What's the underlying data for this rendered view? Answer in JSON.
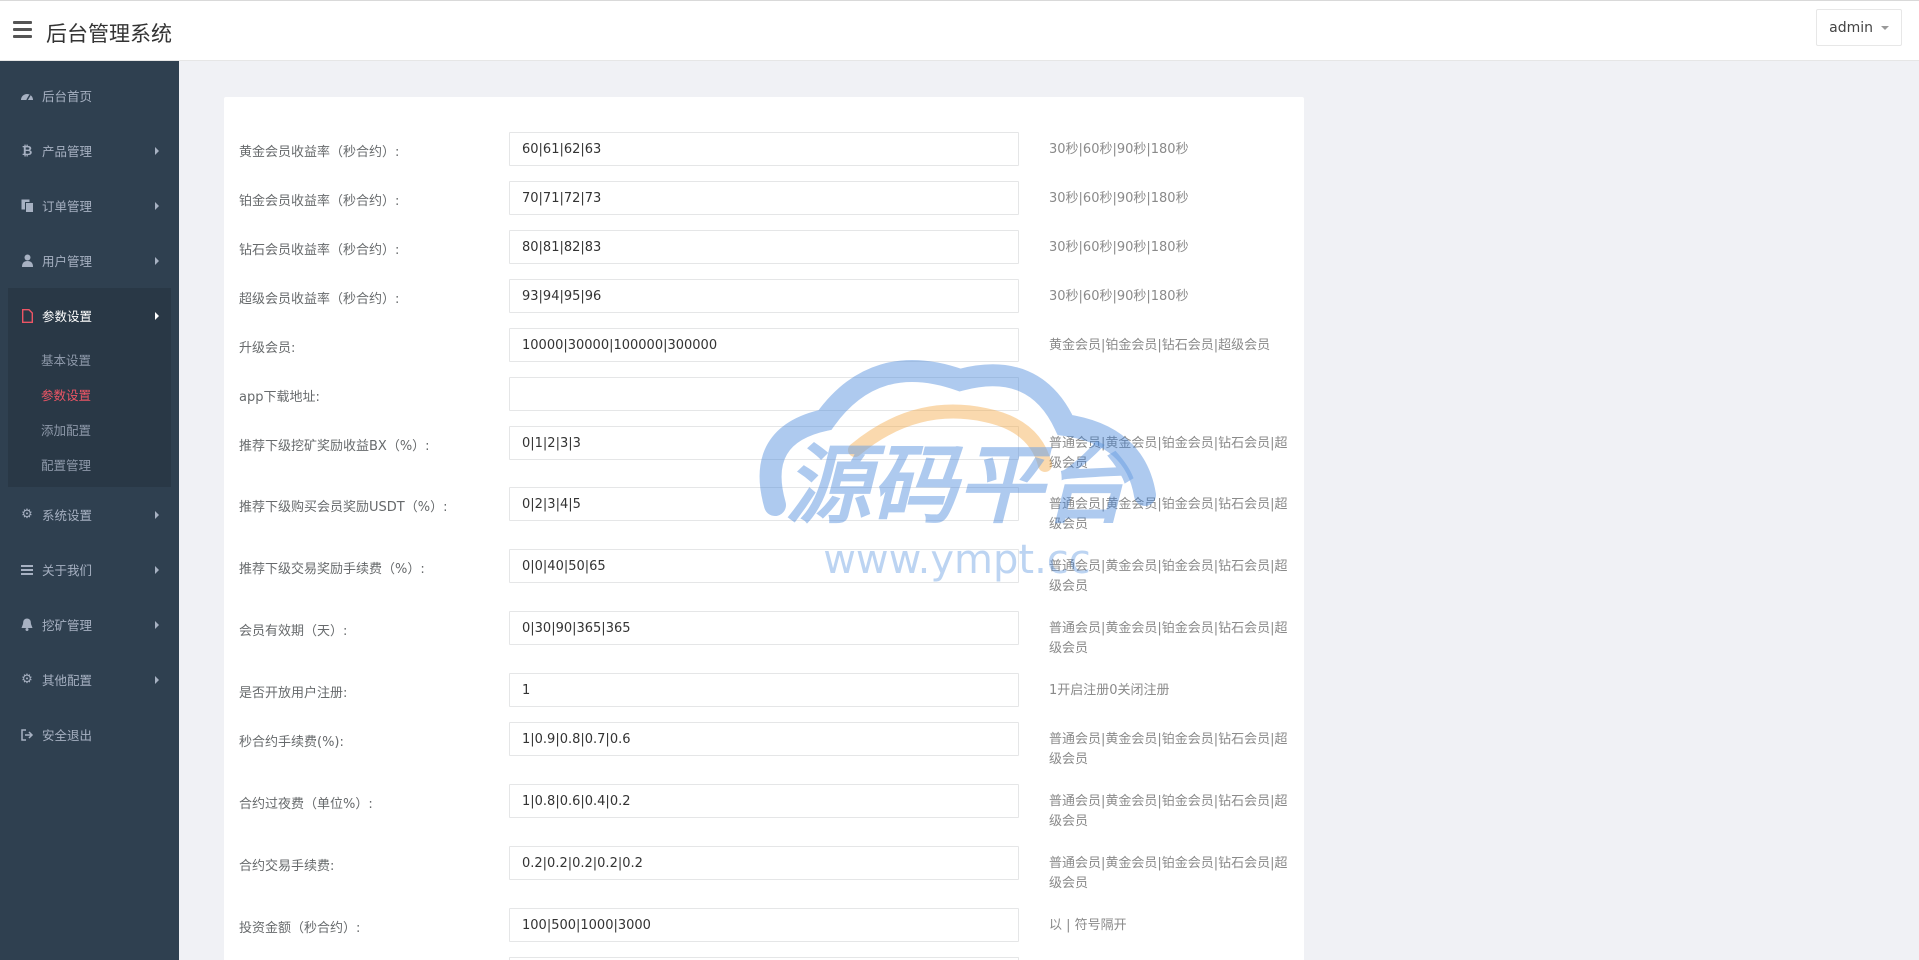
{
  "header": {
    "title": "后台管理系统",
    "user": "admin"
  },
  "sidebar": {
    "items": [
      {
        "label": "后台首页",
        "icon": "dashboard-icon"
      },
      {
        "label": "产品管理",
        "icon": "bitcoin-icon"
      },
      {
        "label": "订单管理",
        "icon": "copy-icon"
      },
      {
        "label": "用户管理",
        "icon": "user-icon"
      },
      {
        "label": "参数设置",
        "icon": "file-icon"
      },
      {
        "label": "系统设置",
        "icon": "cogs-icon"
      },
      {
        "label": "关于我们",
        "icon": "bars-icon"
      },
      {
        "label": "挖矿管理",
        "icon": "bell-icon"
      },
      {
        "label": "其他配置",
        "icon": "gear-icon"
      },
      {
        "label": "安全退出",
        "icon": "sign-out-icon"
      }
    ],
    "subitems": [
      "基本设置",
      "参数设置",
      "添加配置",
      "配置管理"
    ]
  },
  "form": {
    "rows": [
      {
        "label": "黄金会员收益率（秒合约）:",
        "value": "60|61|62|63",
        "help": "30秒|60秒|90秒|180秒"
      },
      {
        "label": "铂金会员收益率（秒合约）:",
        "value": "70|71|72|73",
        "help": "30秒|60秒|90秒|180秒"
      },
      {
        "label": "钻石会员收益率（秒合约）:",
        "value": "80|81|82|83",
        "help": "30秒|60秒|90秒|180秒"
      },
      {
        "label": "超级会员收益率（秒合约）:",
        "value": "93|94|95|96",
        "help": "30秒|60秒|90秒|180秒"
      },
      {
        "label": "升级会员:",
        "value": "10000|30000|100000|300000",
        "help": "黄金会员|铂金会员|钻石会员|超级会员"
      },
      {
        "label": "app下载地址:",
        "value": "",
        "help": ""
      },
      {
        "label": "推荐下级挖矿奖励收益BX（%）:",
        "value": "0|1|2|3|3",
        "help": "普通会员|黄金会员|铂金会员|钻石会员|超级会员"
      },
      {
        "label": "推荐下级购买会员奖励USDT（%）:",
        "value": "0|2|3|4|5",
        "help": "普通会员|黄金会员|铂金会员|钻石会员|超级会员"
      },
      {
        "label": "推荐下级交易奖励手续费（%）:",
        "value": "0|0|40|50|65",
        "help": "普通会员|黄金会员|铂金会员|钻石会员|超级会员"
      },
      {
        "label": "会员有效期（天）:",
        "value": "0|30|90|365|365",
        "help": "普通会员|黄金会员|铂金会员|钻石会员|超级会员"
      },
      {
        "label": "是否开放用户注册:",
        "value": "1",
        "help": "1开启注册0关闭注册"
      },
      {
        "label": "秒合约手续费(%):",
        "value": "1|0.9|0.8|0.7|0.6",
        "help": "普通会员|黄金会员|铂金会员|钻石会员|超级会员"
      },
      {
        "label": "合约过夜费（单位%）:",
        "value": "1|0.8|0.6|0.4|0.2",
        "help": "普通会员|黄金会员|铂金会员|钻石会员|超级会员"
      },
      {
        "label": "合约交易手续费:",
        "value": "0.2|0.2|0.2|0.2|0.2",
        "help": "普通会员|黄金会员|铂金会员|钻石会员|超级会员"
      },
      {
        "label": "投资金额（秒合约）:",
        "value": "100|500|1000|3000",
        "help": "以 | 符号隔开"
      }
    ]
  },
  "watermark": {
    "brand": "源码平台",
    "url": "www.ympt.cc"
  },
  "colors": {
    "sidebar_bg": "#2f4050",
    "sidebar_active_bg": "#293846",
    "accent": "#ed5565",
    "watermark_blue": "#3b7fd9",
    "watermark_orange": "#f4a43a"
  }
}
